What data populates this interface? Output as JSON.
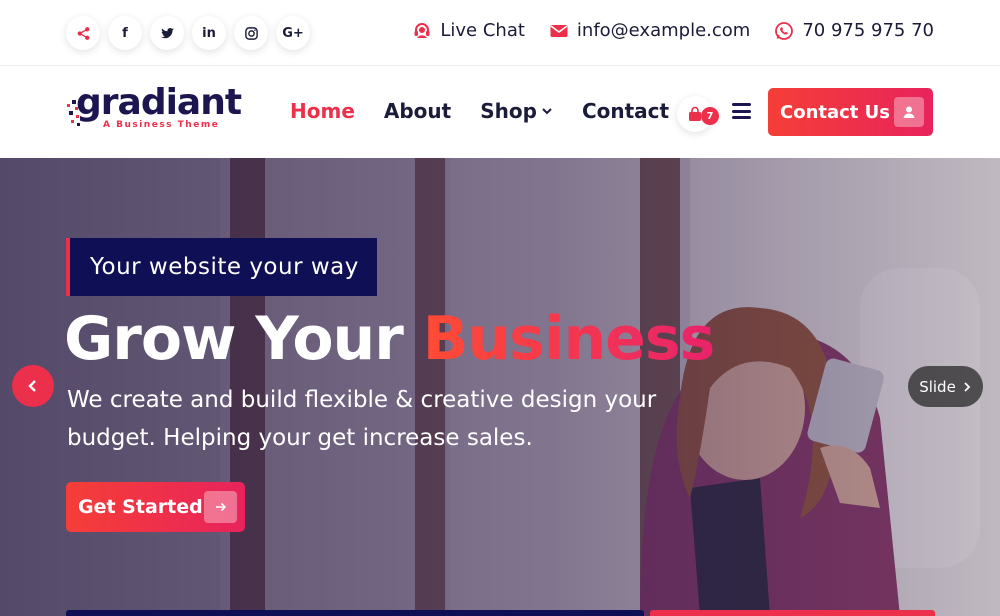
{
  "topbar": {
    "socials": [
      {
        "icon": "share-icon",
        "glyph": ""
      },
      {
        "icon": "facebook-icon",
        "glyph": "f"
      },
      {
        "icon": "twitter-icon",
        "glyph": ""
      },
      {
        "icon": "linkedin-icon",
        "glyph": "in"
      },
      {
        "icon": "instagram-icon",
        "glyph": ""
      },
      {
        "icon": "google-plus-icon",
        "glyph": "G+"
      }
    ],
    "live_chat": "Live Chat",
    "email": "info@example.com",
    "phone": "70 975 975 70"
  },
  "nav": {
    "logo_word": "gradiant",
    "logo_sub": "A Business Theme",
    "items": [
      {
        "label": "Home",
        "active": true
      },
      {
        "label": "About",
        "active": false
      },
      {
        "label": "Shop",
        "active": false,
        "dropdown": true
      },
      {
        "label": "Contact",
        "active": false
      }
    ],
    "cart_count": "7",
    "cta_label": "Contact Us"
  },
  "hero": {
    "tagline": "Your website your way",
    "headline_plain": "Grow Your ",
    "headline_accent": "Business",
    "description": "We create and build flexible & creative design your budget. Helping your get increase sales.",
    "button_label": "Get Started",
    "next_label": "Slide"
  },
  "colors": {
    "accent": "#ec2f4b",
    "navy": "#0f0f55",
    "text": "#1b1b3a"
  }
}
